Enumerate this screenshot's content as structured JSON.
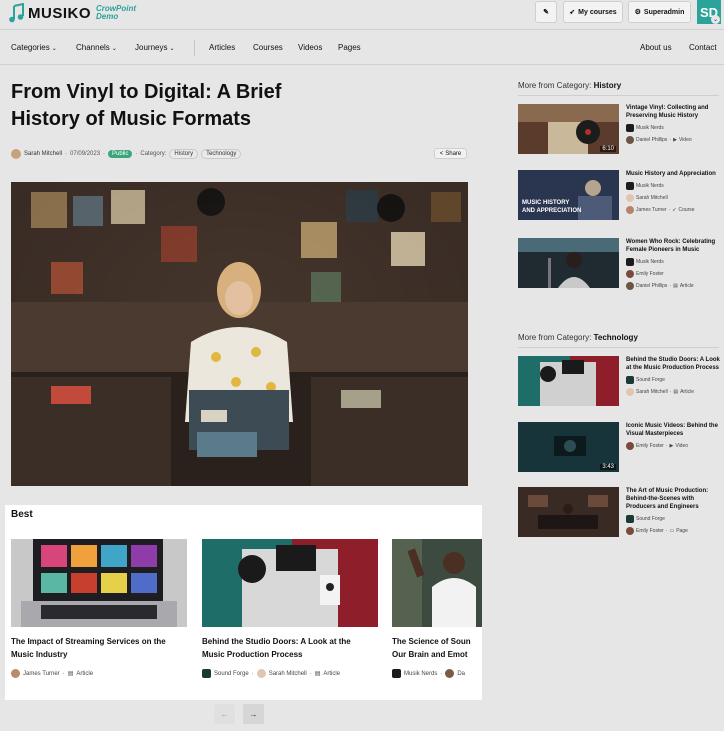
{
  "brand": {
    "name": "MUSIKO",
    "sub_line1": "CrowPoint",
    "sub_line2": "Demo"
  },
  "topbar": {
    "edit_icon": "pencil-icon",
    "my_courses": "My courses",
    "superadmin": "Superadmin",
    "avatar_initials": "SD"
  },
  "nav": {
    "categories": "Categories",
    "channels": "Channels",
    "journeys": "Journeys",
    "articles": "Articles",
    "courses": "Courses",
    "videos": "Videos",
    "pages": "Pages",
    "about": "About us",
    "contact": "Contact"
  },
  "article": {
    "title": "From Vinyl to Digital: A Brief History of Music Formats",
    "author": "Sarah Mitchell",
    "date": "07/09/2023",
    "visibility": "Public",
    "category_label": "Category:",
    "tags": [
      "History",
      "Technology"
    ],
    "share": "Share"
  },
  "best": {
    "title": "Best",
    "cards": [
      {
        "title_line1": "The Impact of Streaming Services on the",
        "title_line2": "Music Industry",
        "author": "James Turner",
        "type": "Article"
      },
      {
        "title_line1": "Behind the Studio Doors: A Look at the",
        "title_line2": "Music Production Process",
        "channel": "Sound Forge",
        "author": "Sarah Mitchell",
        "type": "Article"
      },
      {
        "title_line1": "The Science of Soun",
        "title_line2": "Our Brain and Emot",
        "channel": "Musik Nerds",
        "author": "Da"
      }
    ]
  },
  "sidebar": {
    "history": {
      "prefix": "More from Category:",
      "name": "History",
      "items": [
        {
          "title": "Vintage Vinyl: Collecting and Preserving Music History",
          "channel": "Musik Nerds",
          "author": "Daniel Phillips",
          "type": "Video",
          "duration": "6:10"
        },
        {
          "title": "Music History and Appreciation",
          "channel": "Musik Nerds",
          "author": "Sarah Mitchell",
          "author2": "James Turner",
          "type": "Course",
          "thumb_text_1": "MUSIC HISTORY",
          "thumb_text_2": "AND APPRECIATION"
        },
        {
          "title": "Women Who Rock: Celebrating Female Pioneers in Music",
          "channel": "Musik Nerds",
          "author": "Emily Foster",
          "author2": "Daniel Phillips",
          "type": "Article"
        }
      ]
    },
    "technology": {
      "prefix": "More from Category:",
      "name": "Technology",
      "items": [
        {
          "title": "Behind the Studio Doors: A Look at the Music Production Process",
          "channel": "Sound Forge",
          "author": "Sarah Mitchell",
          "type": "Article"
        },
        {
          "title": "Iconic Music Videos: Behind the Visual Masterpieces",
          "author": "Emily Foster",
          "type": "Video",
          "duration": "3:43"
        },
        {
          "title": "The Art of Music Production: Behind-the-Scenes with Producers and Engineers",
          "channel": "Sound Forge",
          "author": "Emily Foster",
          "type": "Page"
        }
      ]
    }
  },
  "pager": {
    "prev": "←",
    "next": "→"
  },
  "colors": {
    "accent": "#2aa39a",
    "public_badge": "#3aa77a",
    "page_bg": "#e6e6e6"
  }
}
